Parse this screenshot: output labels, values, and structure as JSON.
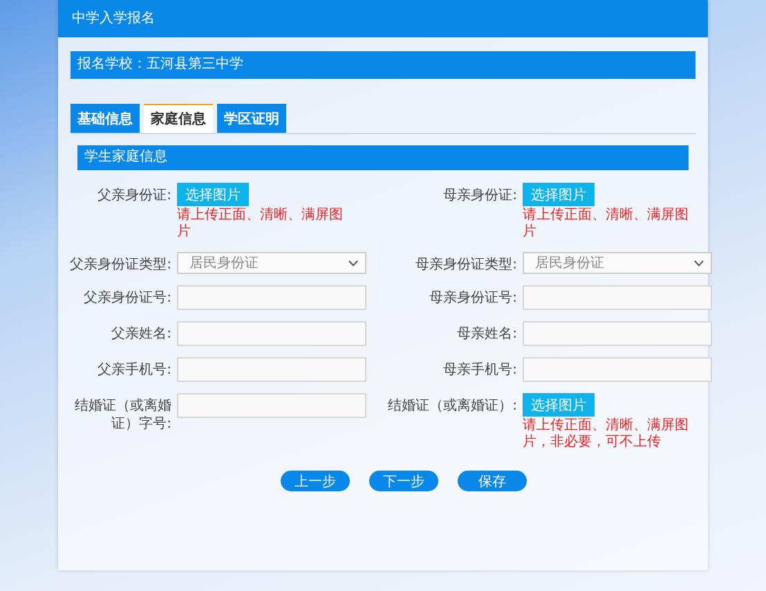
{
  "window": {
    "title": "中学入学报名"
  },
  "school": "报名学校：五河县第三中学",
  "tabs": [
    {
      "label": "基础信息",
      "selected": false
    },
    {
      "label": "家庭信息",
      "selected": true
    },
    {
      "label": "学区证明",
      "selected": false
    }
  ],
  "section": {
    "title": "学生家庭信息"
  },
  "rows": [
    {
      "left": {
        "kind": "upload",
        "label": "父亲身份证:",
        "button": "选择图片",
        "hint": "请上传正面、清晰、满屏图片"
      },
      "right": {
        "kind": "upload",
        "label": "母亲身份证:",
        "button": "选择图片",
        "hint": "请上传正面、清晰、满屏图片"
      }
    },
    {
      "left": {
        "kind": "select",
        "label": "父亲身份证类型:",
        "value": "居民身份证"
      },
      "right": {
        "kind": "select",
        "label": "母亲身份证类型:",
        "value": "居民身份证"
      }
    },
    {
      "left": {
        "kind": "input",
        "label": "父亲身份证号:"
      },
      "right": {
        "kind": "input",
        "label": "母亲身份证号:"
      }
    },
    {
      "left": {
        "kind": "input",
        "label": "父亲姓名:"
      },
      "right": {
        "kind": "input",
        "label": "母亲姓名:"
      }
    },
    {
      "left": {
        "kind": "input",
        "label": "父亲手机号:"
      },
      "right": {
        "kind": "input",
        "label": "母亲手机号:"
      }
    },
    {
      "left": {
        "kind": "input",
        "label": "结婚证（或离婚证）字号:"
      },
      "right": {
        "kind": "upload",
        "label": "结婚证（或离婚证）:",
        "button": "选择图片",
        "hint": "请上传正面、清晰、满屏图片，非必要，可不上传"
      }
    }
  ],
  "buttons": [
    "上一步",
    "下一步",
    "保存"
  ]
}
